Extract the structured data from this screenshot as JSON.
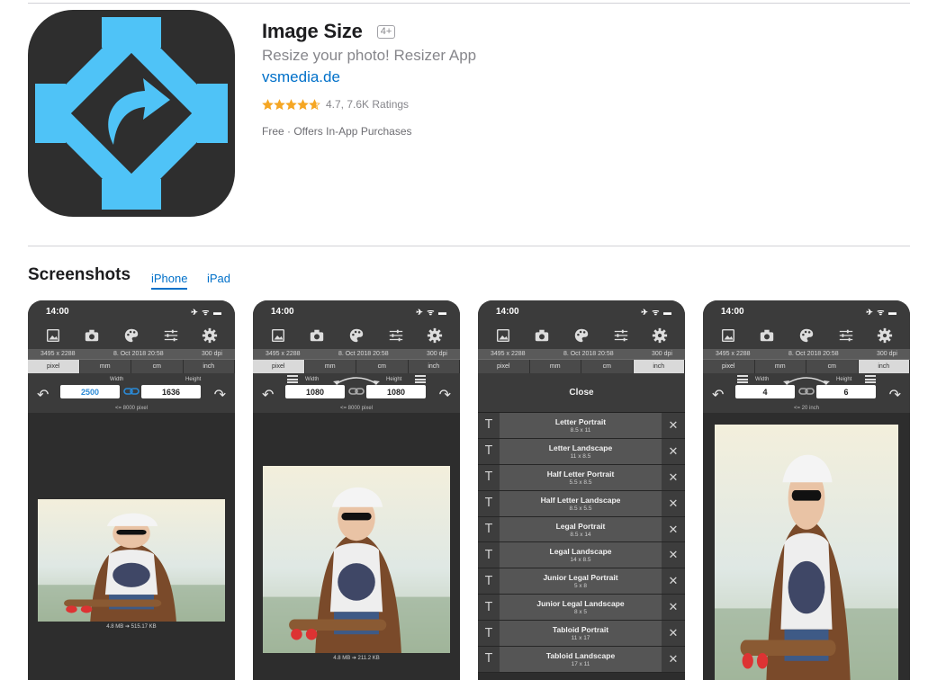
{
  "app": {
    "title": "Image Size",
    "age_rating": "4+",
    "subtitle": "Resize your photo! Resizer App",
    "developer": "vsmedia.de",
    "rating_value": 4.7,
    "rating_text": "4.7, 7.6K Ratings",
    "price_text": "Free · Offers In-App Purchases",
    "icon_name": "image-size-app-icon",
    "accent_color": "#4fc3f7"
  },
  "screenshots_section": {
    "title": "Screenshots",
    "tabs": [
      {
        "label": "iPhone",
        "active": true
      },
      {
        "label": "iPad",
        "active": false
      }
    ]
  },
  "phone": {
    "time": "14:00",
    "status_icons": "✈ ᯤ ▬",
    "info": [
      "3495 x 2288",
      "8. Oct 2018 20:58",
      "300 dpi"
    ],
    "units": [
      "pixel",
      "mm",
      "cm",
      "inch"
    ],
    "width_label": "Width",
    "height_label": "Height"
  },
  "screens": [
    {
      "selected_unit": "pixel",
      "width": "2500",
      "height": "1636",
      "limit": "<= 8000 pixel",
      "size_note": "4.8 MB  ➔  515.17 KB"
    },
    {
      "selected_unit": "pixel",
      "width": "1080",
      "height": "1080",
      "limit": "<= 8000 pixel",
      "size_note": "4.8 MB  ➔  211.2 KB"
    },
    {
      "selected_unit": "inch",
      "close_label": "Close"
    },
    {
      "selected_unit": "inch",
      "width": "4",
      "height": "6",
      "limit": "<= 20 inch"
    }
  ],
  "presets": [
    {
      "name": "Letter Portrait",
      "dim": "8.5 x 11"
    },
    {
      "name": "Letter Landscape",
      "dim": "11 x 8.5"
    },
    {
      "name": "Half Letter Portrait",
      "dim": "5.5 x 8.5"
    },
    {
      "name": "Half Letter Landscape",
      "dim": "8.5 x 5.5"
    },
    {
      "name": "Legal Portrait",
      "dim": "8.5 x 14"
    },
    {
      "name": "Legal Landscape",
      "dim": "14 x 8.5"
    },
    {
      "name": "Junior Legal Portrait",
      "dim": "5 x 8"
    },
    {
      "name": "Junior Legal Landscape",
      "dim": "8 x 5"
    },
    {
      "name": "Tabloid Portrait",
      "dim": "11 x 17"
    },
    {
      "name": "Tabloid Landscape",
      "dim": "17 x 11"
    }
  ]
}
